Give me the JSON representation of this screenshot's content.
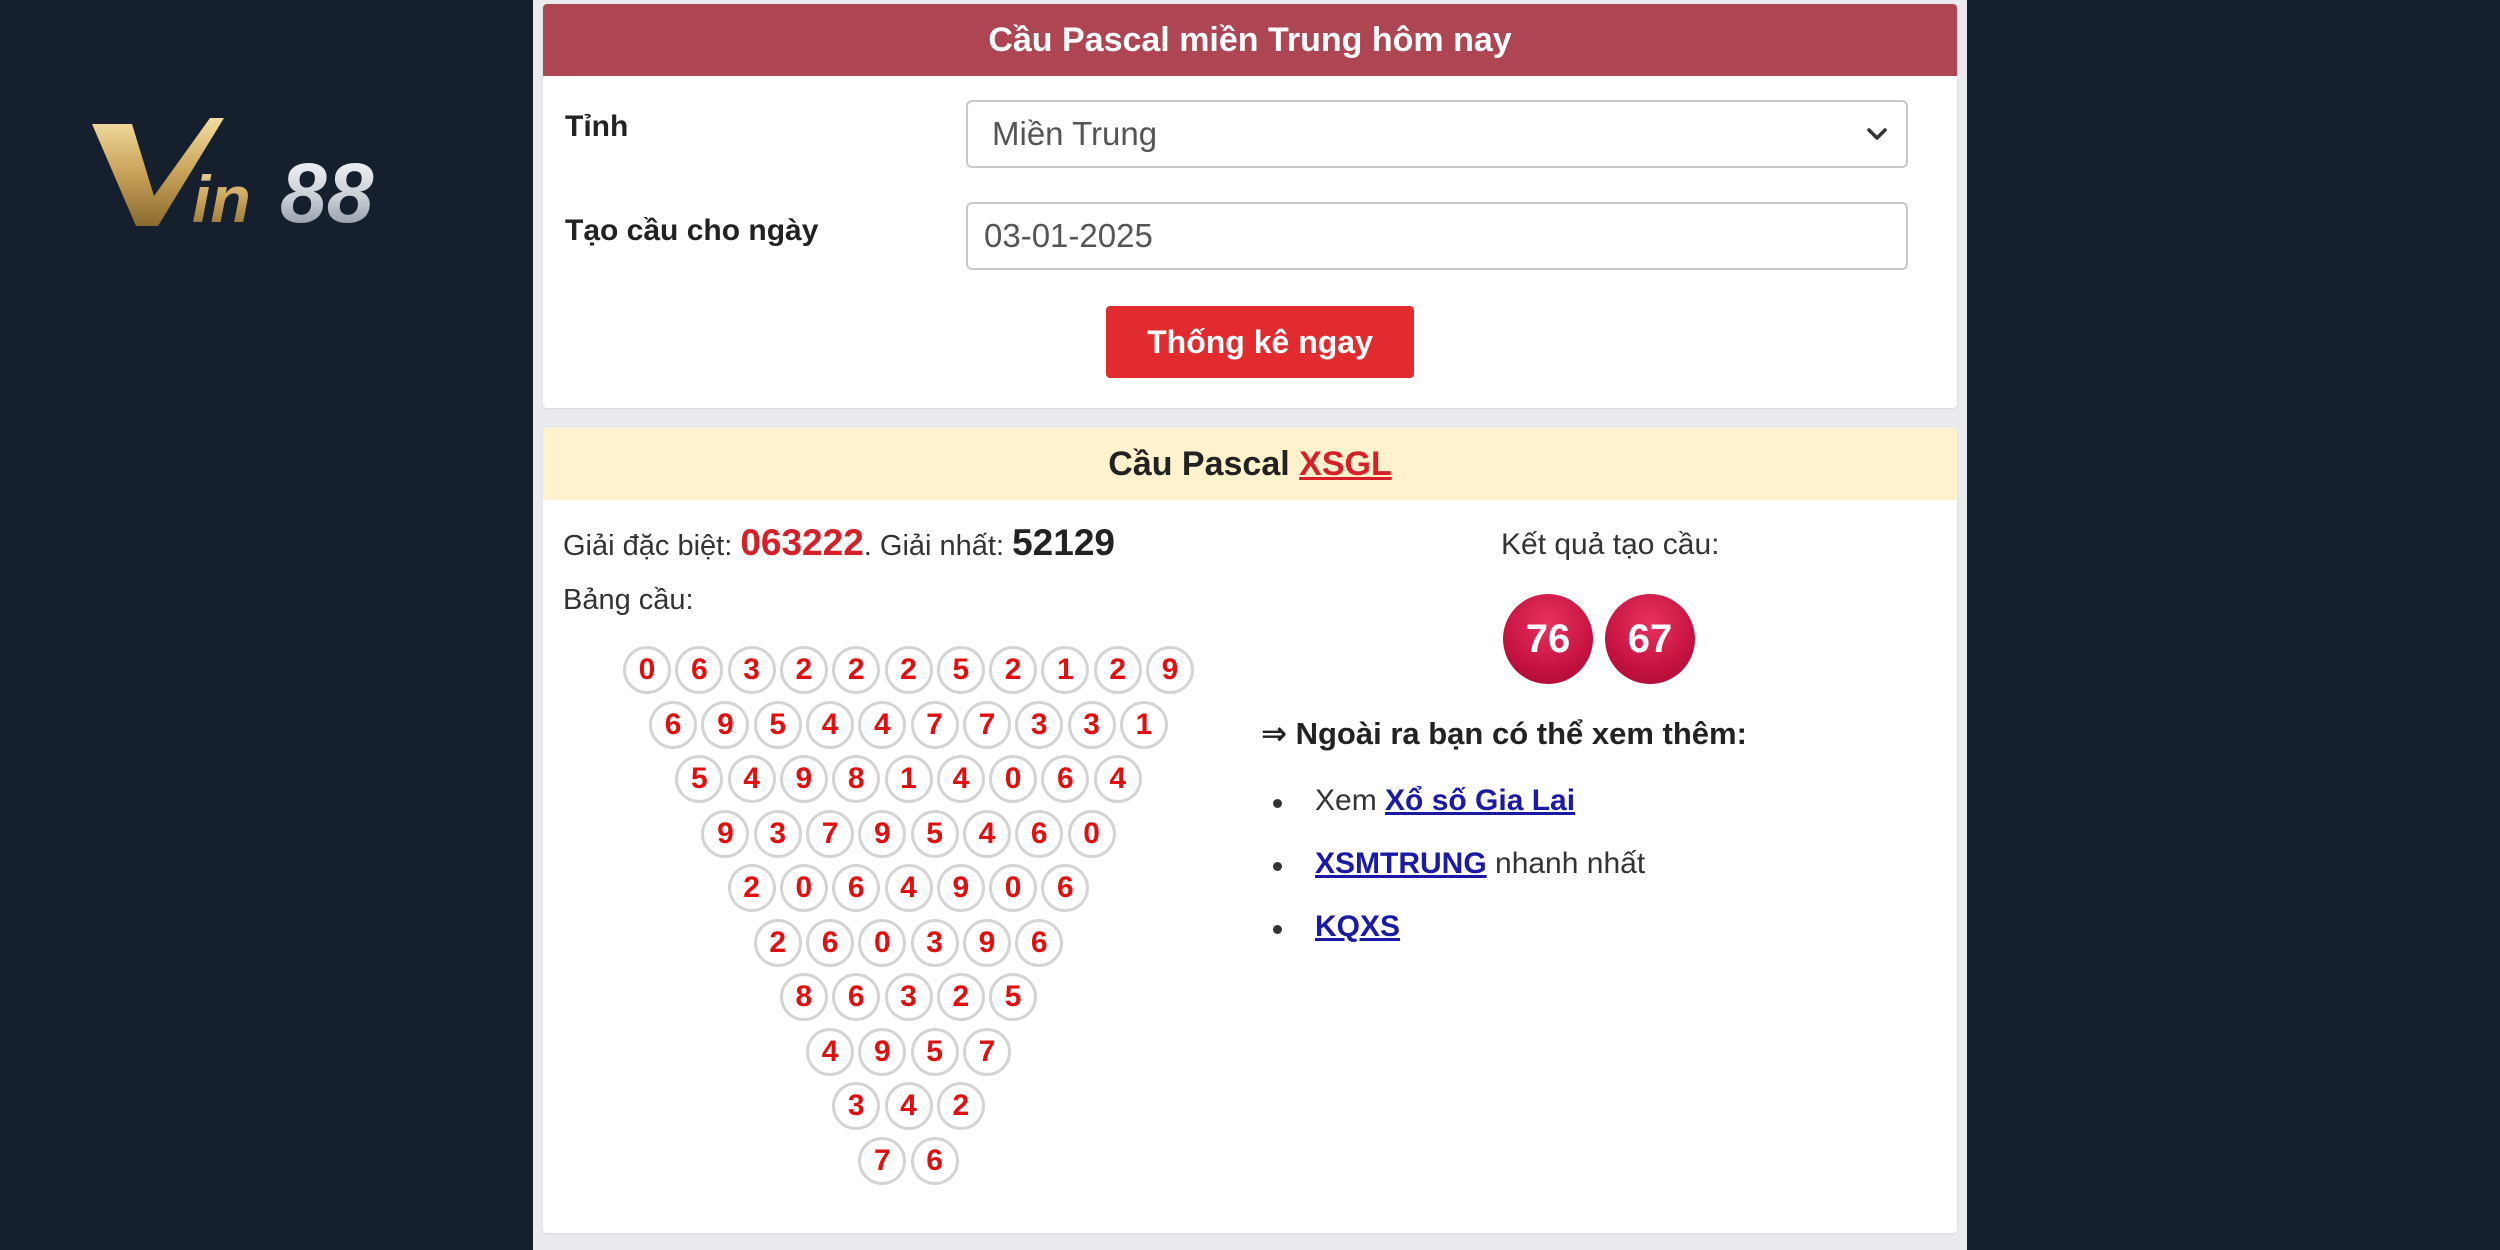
{
  "logo": {
    "text": "Vin88"
  },
  "form": {
    "title": "Cầu Pascal miền Trung hôm nay",
    "province_label": "Tỉnh",
    "province_value": "Miền Trung",
    "date_label": "Tạo cầu cho ngày",
    "date_value": "03-01-2025",
    "submit_label": "Thống kê ngay"
  },
  "result": {
    "title_prefix": "Cầu Pascal",
    "title_link": "XSGL",
    "special_label": "Giải đặc biệt:",
    "special_value": "063222",
    "first_label": ". Giải nhất:",
    "first_value": "52129",
    "table_label": "Bảng cầu:",
    "triangle": [
      [
        0,
        6,
        3,
        2,
        2,
        2,
        5,
        2,
        1,
        2,
        9
      ],
      [
        6,
        9,
        5,
        4,
        4,
        7,
        7,
        3,
        3,
        1
      ],
      [
        5,
        4,
        9,
        8,
        1,
        4,
        0,
        6,
        4
      ],
      [
        9,
        3,
        7,
        9,
        5,
        4,
        6,
        0
      ],
      [
        2,
        0,
        6,
        4,
        9,
        0,
        6
      ],
      [
        2,
        6,
        0,
        3,
        9,
        6
      ],
      [
        8,
        6,
        3,
        2,
        5
      ],
      [
        4,
        9,
        5,
        7
      ],
      [
        3,
        4,
        2
      ],
      [
        7,
        6
      ]
    ],
    "outcome_label": "Kết quả tạo cầu:",
    "outcome_values": [
      "76",
      "67"
    ],
    "more_heading": "⇒ Ngoài ra bạn có thể xem thêm:",
    "more_links": [
      {
        "prefix": "Xem ",
        "link": "Xổ số Gia Lai",
        "suffix": ""
      },
      {
        "prefix": "",
        "link": "XSMTRUNG",
        "suffix": " nhanh nhất"
      },
      {
        "prefix": "",
        "link": "KQXS",
        "suffix": ""
      }
    ]
  },
  "colors": {
    "page_bg": "#161f2e",
    "header_bg": "#ad4552",
    "button_bg": "#e12b2f",
    "result_header_bg": "#fff2cc",
    "accent_red": "#d61f26",
    "ball_gradient": "#c51240",
    "link": "#1a1aa6"
  },
  "icons": {
    "select_caret": "chevron-down-icon"
  }
}
